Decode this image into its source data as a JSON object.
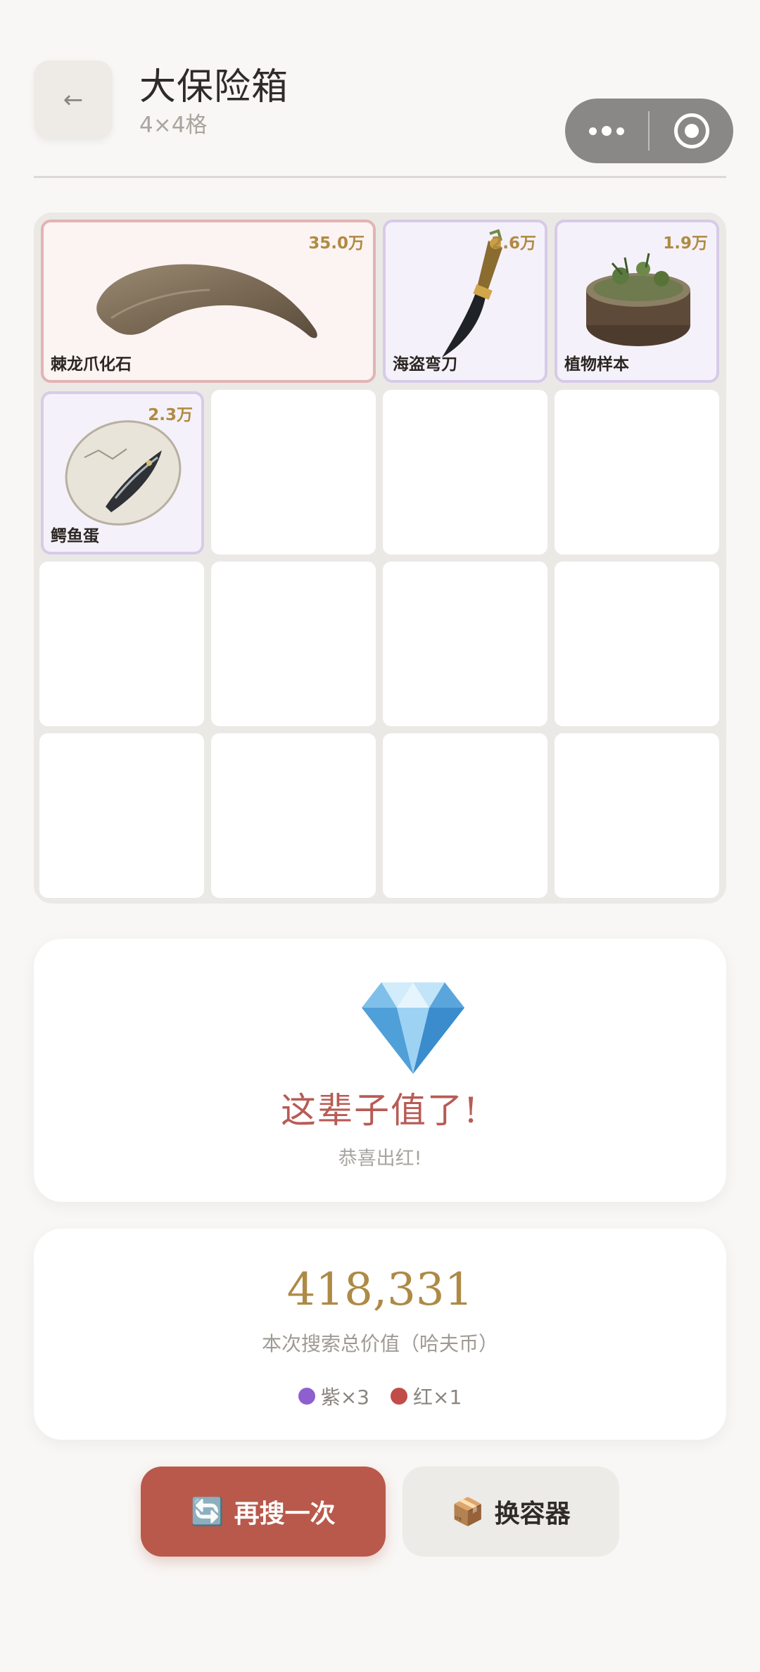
{
  "header": {
    "back_icon": "←",
    "title": "大保险箱",
    "subtitle": "4×4格"
  },
  "capsule": {
    "more_icon": "more-dots-icon",
    "close_icon": "target-circle-icon"
  },
  "grid": {
    "rows": 4,
    "cols": 4,
    "items": [
      {
        "name": "棘龙爪化石",
        "price": "35.0万",
        "rarity": "red",
        "icon": "claw-fossil-icon"
      },
      {
        "name": "海盗弯刀",
        "price": "2.6万",
        "rarity": "purple",
        "icon": "pirate-knife-icon"
      },
      {
        "name": "植物样本",
        "price": "1.9万",
        "rarity": "purple",
        "icon": "plant-sample-icon"
      },
      {
        "name": "鳄鱼蛋",
        "price": "2.3万",
        "rarity": "purple",
        "icon": "crocodile-egg-icon"
      }
    ]
  },
  "result": {
    "icon": "diamond-icon",
    "title": "这辈子值了!",
    "subtitle": "恭喜出红!"
  },
  "value": {
    "total": "418,331",
    "label": "本次搜索总价值（哈夫币）",
    "purple_label": "紫×3",
    "red_label": "红×1",
    "purple_color": "#8e5fcf",
    "red_color": "#c14c48"
  },
  "buttons": {
    "search_again_icon": "🔄",
    "search_again": "再搜一次",
    "change_container_icon": "📦",
    "change_container": "换容器"
  }
}
